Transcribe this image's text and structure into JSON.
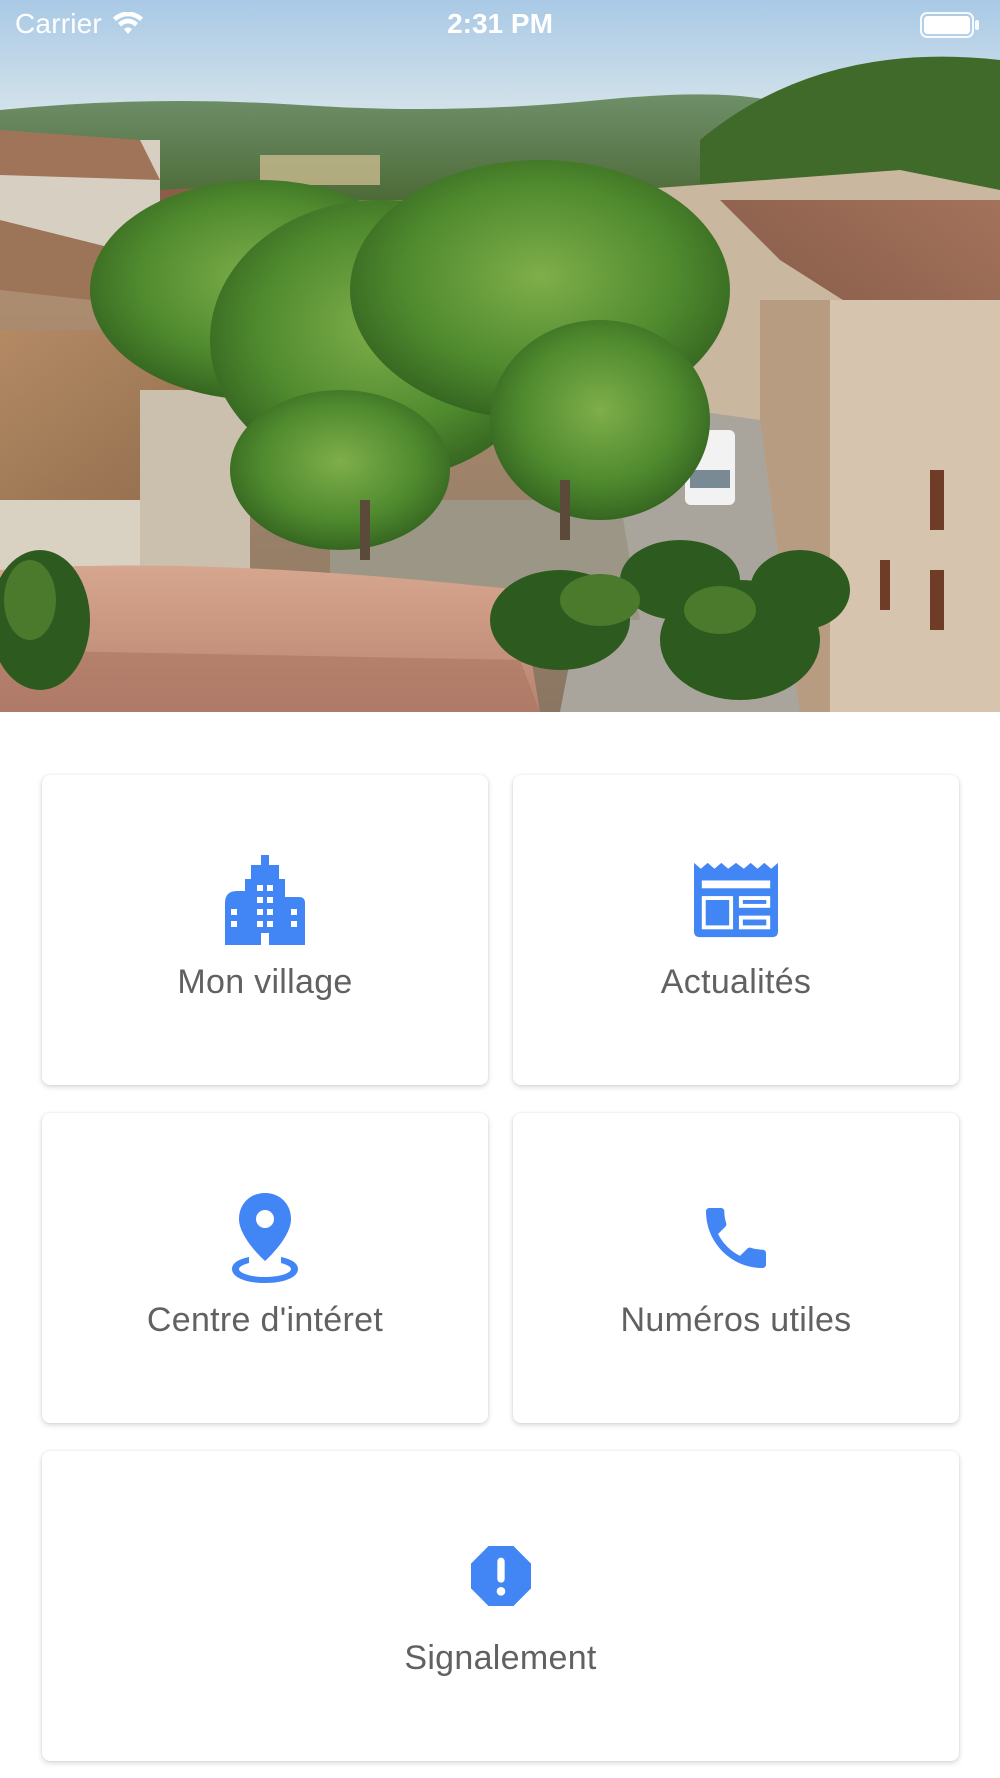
{
  "status_bar": {
    "carrier": "Carrier",
    "time": "2:31 PM",
    "wifi_icon": "wifi-icon",
    "battery_icon": "battery-icon"
  },
  "hero": {
    "image": "village-street-photo"
  },
  "accent_color": "#4285F4",
  "label_color": "#616161",
  "menu": {
    "village": {
      "label": "Mon village",
      "icon": "city-buildings-icon"
    },
    "news": {
      "label": "Actualités",
      "icon": "newspaper-icon"
    },
    "poi": {
      "label": "Centre d'intéret",
      "icon": "map-pin-icon"
    },
    "phones": {
      "label": "Numéros utiles",
      "icon": "phone-icon"
    },
    "report": {
      "label": "Signalement",
      "icon": "alert-octagon-icon"
    }
  }
}
